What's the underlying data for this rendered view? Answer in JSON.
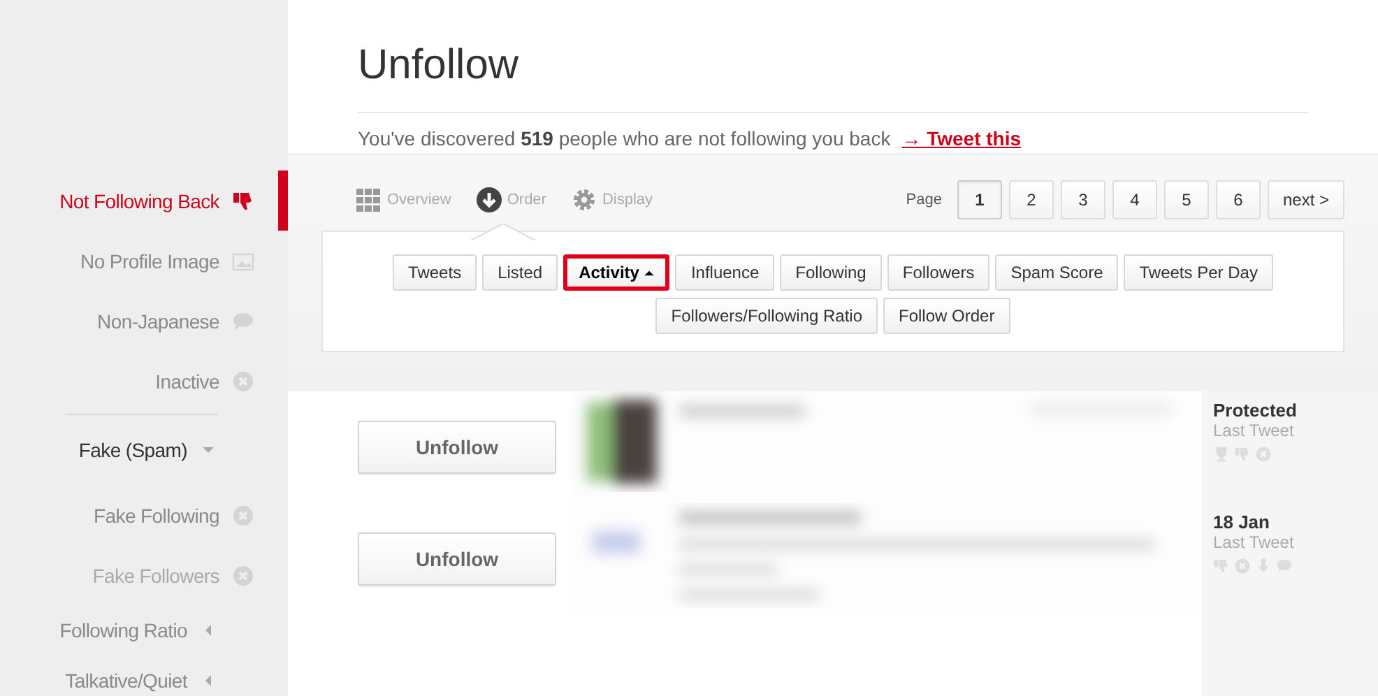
{
  "sidebar": {
    "items": [
      {
        "kind": "filter",
        "label": "Not Following Back",
        "selected": true,
        "disabled": false
      },
      {
        "kind": "filter",
        "label": "No Profile Image",
        "selected": false,
        "disabled": false
      },
      {
        "kind": "filter",
        "label": "Non-Japanese",
        "selected": false,
        "disabled": false
      },
      {
        "kind": "filter",
        "label": "Inactive",
        "selected": false,
        "disabled": false
      },
      {
        "kind": "group",
        "label": "Fake (Spam)",
        "expanded": true,
        "children": [
          {
            "label": "Fake Following",
            "selected": false,
            "disabled": false
          },
          {
            "label": "Fake Followers",
            "selected": false,
            "disabled": true
          }
        ]
      },
      {
        "kind": "group",
        "label": "Following Ratio",
        "expanded": false
      },
      {
        "kind": "group",
        "label": "Talkative/Quiet",
        "expanded": false
      }
    ]
  },
  "header": {
    "title": "Unfollow",
    "summary": "You've discovered **519** people who are not following you back",
    "link": "→ Tweet this"
  },
  "view_tabs": [
    {
      "label": "Overview",
      "selected": false
    },
    {
      "label": "Order",
      "selected": true
    },
    {
      "label": "Display",
      "selected": false
    }
  ],
  "pagination": {
    "label": "Page",
    "pages": [
      {
        "label": "1",
        "selected": true
      },
      {
        "label": "2",
        "selected": false
      },
      {
        "label": "3",
        "selected": false
      },
      {
        "label": "4",
        "selected": false
      },
      {
        "label": "5",
        "selected": false
      },
      {
        "label": "6",
        "selected": false
      }
    ],
    "next": "next >"
  },
  "sort_options": [
    {
      "label": "Tweets",
      "selected": false
    },
    {
      "label": "Listed",
      "selected": false
    },
    {
      "label": "Activity",
      "selected": true
    },
    {
      "label": "Influence",
      "selected": false
    },
    {
      "label": "Following",
      "selected": false
    },
    {
      "label": "Followers",
      "selected": false
    },
    {
      "label": "Spam Score",
      "selected": false
    },
    {
      "label": "Tweets Per Day",
      "selected": false
    },
    {
      "label": "Followers/Following Ratio",
      "selected": false
    },
    {
      "label": "Follow Order",
      "selected": false
    }
  ],
  "rows": [
    {
      "button": "Unfollow",
      "status": "Protected",
      "status_label": "Last Tweet"
    },
    {
      "button": "Unfollow",
      "status": "18 Jan",
      "status_label": "Last Tweet"
    }
  ]
}
